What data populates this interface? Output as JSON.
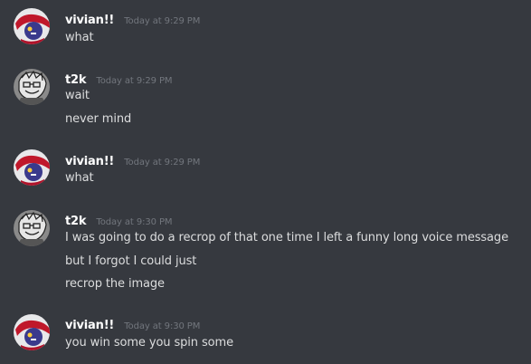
{
  "messages": [
    {
      "author": "vivian!!",
      "timestamp": "Today at 9:29 PM",
      "avatar_icon": "vivian-avatar",
      "lines": [
        "what"
      ]
    },
    {
      "author": "t2k",
      "timestamp": "Today at 9:29 PM",
      "avatar_icon": "t2k-avatar",
      "lines": [
        "wait",
        "never mind"
      ]
    },
    {
      "author": "vivian!!",
      "timestamp": "Today at 9:29 PM",
      "avatar_icon": "vivian-avatar",
      "lines": [
        "what"
      ]
    },
    {
      "author": "t2k",
      "timestamp": "Today at 9:30 PM",
      "avatar_icon": "t2k-avatar",
      "lines": [
        "I was going to do a recrop of that one time I left a funny long voice message",
        "but I forgot I could just",
        "recrop the image"
      ]
    },
    {
      "author": "vivian!!",
      "timestamp": "Today at 9:30 PM",
      "avatar_icon": "vivian-avatar",
      "lines": [
        "you win some you spin some"
      ]
    }
  ],
  "colors": {
    "background": "#36393f",
    "author": "#ffffff",
    "timestamp": "#72767d",
    "message_text": "#dcddde"
  }
}
